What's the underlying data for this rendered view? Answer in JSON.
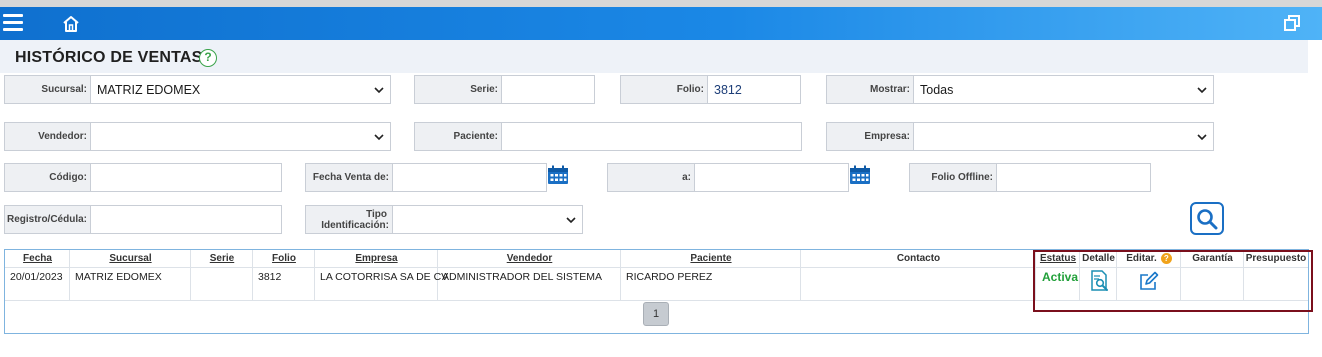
{
  "header": {
    "icons": [
      "menu-icon",
      "home-icon",
      "window-restore-icon"
    ]
  },
  "page": {
    "title": "HISTÓRICO DE VENTAS",
    "help": "?"
  },
  "filters": {
    "sucursal": {
      "label": "Sucursal:",
      "value": "MATRIZ EDOMEX"
    },
    "serie": {
      "label": "Serie:",
      "value": ""
    },
    "folio": {
      "label": "Folio:",
      "value": "3812"
    },
    "mostrar": {
      "label": "Mostrar:",
      "value": "Todas"
    },
    "vendedor": {
      "label": "Vendedor:",
      "value": ""
    },
    "paciente": {
      "label": "Paciente:",
      "value": ""
    },
    "empresa": {
      "label": "Empresa:",
      "value": ""
    },
    "codigo": {
      "label": "Código:",
      "value": ""
    },
    "fecha_venta_de": {
      "label": "Fecha Venta de:",
      "value": ""
    },
    "a": {
      "label": "a:",
      "value": ""
    },
    "folio_offline": {
      "label": "Folio Offline:",
      "value": ""
    },
    "registro_cedula": {
      "label": "Registro/Cédula:",
      "value": ""
    },
    "tipo_identificacion": {
      "label_line1": "Tipo",
      "label_line2": "Identificación:",
      "value": ""
    }
  },
  "table": {
    "columns": [
      "Fecha",
      "Sucursal",
      "Serie",
      "Folio",
      "Empresa",
      "Vendedor",
      "Paciente",
      "Contacto",
      "Estatus",
      "Detalle",
      "Editar.",
      "Garantía",
      "Presupuesto"
    ],
    "rows": [
      {
        "fecha": "20/01/2023",
        "sucursal": "MATRIZ EDOMEX",
        "serie": "",
        "folio": "3812",
        "empresa": "LA COTORRISA SA DE CV",
        "vendedor": "ADMINISTRADOR DEL SISTEMA",
        "paciente": "RICARDO PEREZ",
        "contacto": "",
        "estatus": "Activa",
        "garantia": "",
        "presupuesto": ""
      }
    ],
    "pagination": {
      "current_page": "1"
    },
    "editar_help": "?"
  },
  "colors": {
    "topbar": "#1b88e6",
    "accent": "#1a6fc4",
    "status_active": "#22a03a",
    "highlight": "#7a0f1c"
  }
}
